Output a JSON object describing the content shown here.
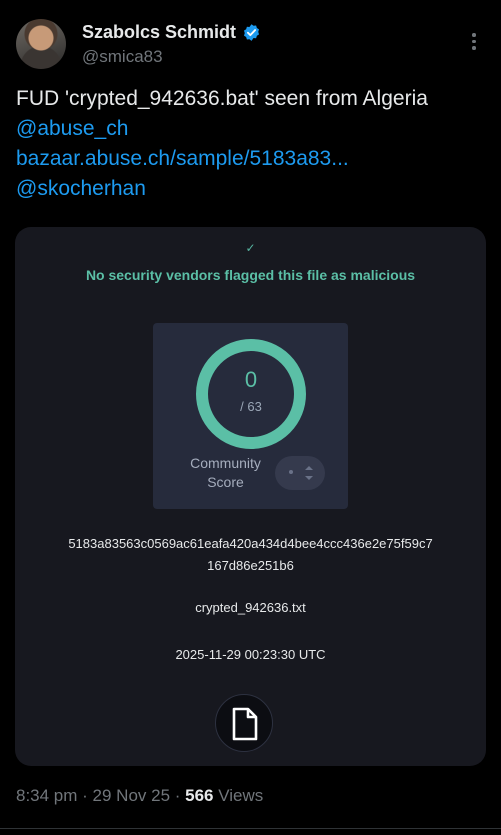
{
  "author": {
    "display_name": "Szabolcs Schmidt",
    "handle": "@smica83"
  },
  "tweet": {
    "text": "FUD 'crypted_942636.bat' seen from Algeria",
    "mention_1": "@abuse_ch",
    "link": "bazaar.abuse.ch/sample/5183a83...",
    "mention_2": "@skocherhan"
  },
  "card": {
    "check_glyph": "✓",
    "status_text": "No security vendors flagged this file as malicious",
    "score": "0",
    "score_total": "/ 63",
    "community_label": "Community Score",
    "hash_line_1": "5183a83563c0569ac61eafa420a434d4bee4ccc436e2e75f59c7",
    "hash_line_2": "167d86e251b6",
    "filename": "crypted_942636.txt",
    "timestamp": "2025-11-29 00:23:30 UTC",
    "accent_color": "#5bbfa6"
  },
  "meta": {
    "time_date": "8:34 pm · 29 Nov 25 · ",
    "views_count": "566",
    "views_label": " Views"
  }
}
